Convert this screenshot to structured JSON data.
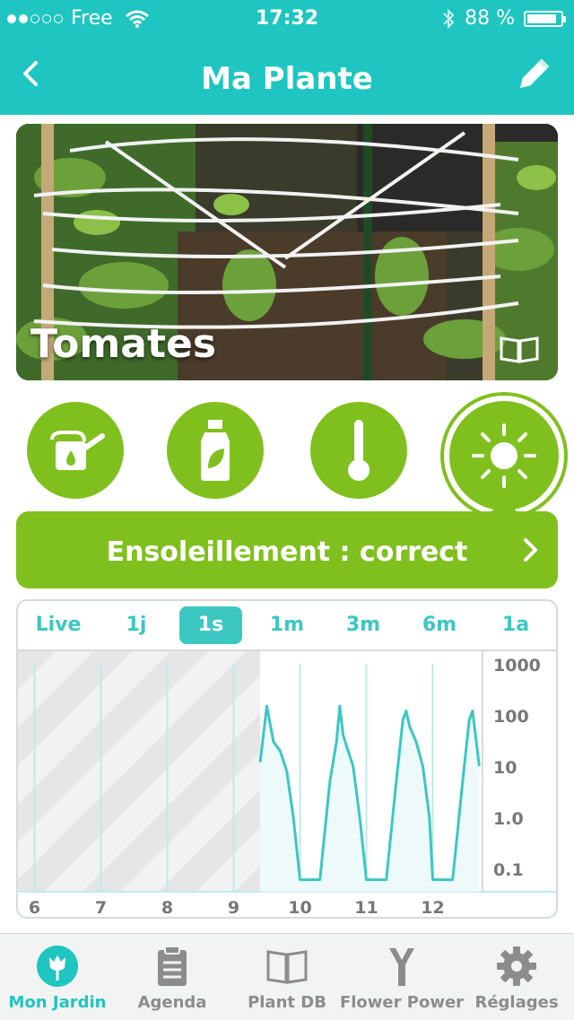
{
  "status": {
    "carrier": "Free",
    "time": "17:32",
    "battery_text": "88 %",
    "battery_level": 0.88,
    "signal_bars_filled": 2,
    "signal_bars_total": 5
  },
  "nav": {
    "title": "Ma Plante",
    "back_icon": "chevron-left-icon",
    "edit_icon": "pencil-icon"
  },
  "plant": {
    "name": "Tomates",
    "guide_icon": "book-icon"
  },
  "sensors": [
    {
      "name": "watering-can-icon",
      "active": false
    },
    {
      "name": "fertilizer-bottle-icon",
      "active": false
    },
    {
      "name": "thermometer-icon",
      "active": false
    },
    {
      "name": "sun-icon",
      "active": true
    }
  ],
  "banner": {
    "text": "Ensoleillement : correct"
  },
  "chart_data": {
    "type": "line",
    "periods": [
      "Live",
      "1j",
      "1s",
      "1m",
      "3m",
      "6m",
      "1a"
    ],
    "selected_period": "1s",
    "x_tick_labels": [
      "6",
      "7",
      "8",
      "9",
      "10",
      "11",
      "12"
    ],
    "y_tick_labels": [
      "1000",
      "100",
      "10",
      "1.0",
      "0.1"
    ],
    "y_scale": "log",
    "ylim": [
      0.1,
      1000
    ],
    "no_data_until_x": 9.4,
    "series": [
      {
        "x": [
          9.4,
          9.5,
          9.6,
          9.7,
          9.8,
          9.9,
          10.0,
          10.05,
          10.3,
          10.45,
          10.55,
          10.6,
          10.65,
          10.7,
          10.8,
          10.9,
          11.0,
          11.05,
          11.3,
          11.45,
          11.55,
          11.6,
          11.65,
          11.75,
          11.85,
          11.95,
          12.0,
          12.05,
          12.3,
          12.45,
          12.55,
          12.6,
          12.7
        ],
        "y": [
          12,
          150,
          30,
          20,
          8,
          1,
          0.06,
          0.06,
          0.06,
          5,
          30,
          150,
          40,
          25,
          10,
          1,
          0.06,
          0.06,
          0.06,
          5,
          80,
          120,
          60,
          30,
          10,
          1,
          0.06,
          0.06,
          0.06,
          5,
          80,
          120,
          10
        ]
      }
    ],
    "colors": {
      "line": "#3cc7c2",
      "fill": "#eefafa",
      "no_data": "#ececec"
    }
  },
  "tabbar": [
    {
      "label": "Mon Jardin",
      "icon": "tulip-icon",
      "active": true
    },
    {
      "label": "Agenda",
      "icon": "clipboard-icon",
      "active": false
    },
    {
      "label": "Plant DB",
      "icon": "book-icon",
      "active": false
    },
    {
      "label": "Flower Power",
      "icon": "flower-power-sensor-icon",
      "active": false
    },
    {
      "label": "Réglages",
      "icon": "gear-icon",
      "active": false
    }
  ],
  "colors": {
    "accent": "#1fc5c0",
    "green": "#80c01e",
    "tab_inactive": "#8c8c8c"
  }
}
